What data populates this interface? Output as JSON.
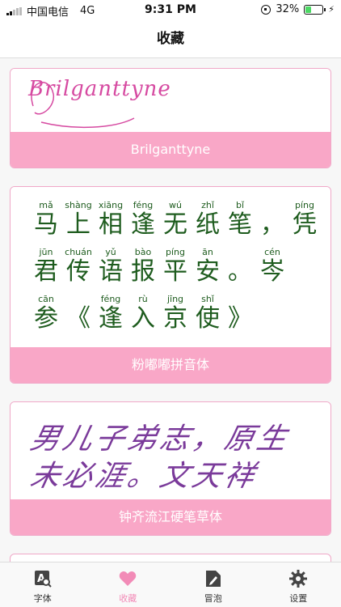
{
  "status": {
    "carrier": "中国电信",
    "network": "4G",
    "time": "9:31 PM",
    "battery": "32%",
    "battery_level": 0.32
  },
  "nav": {
    "title": "收藏"
  },
  "cards": [
    {
      "logo_text": "Brilganttyne",
      "name": "Brilganttyne"
    },
    {
      "name": "粉嘟嘟拼音体",
      "rows": [
        [
          {
            "py": "mǎ",
            "hz": "马"
          },
          {
            "py": "shàng",
            "hz": "上"
          },
          {
            "py": "xiāng",
            "hz": "相"
          },
          {
            "py": "féng",
            "hz": "逢"
          },
          {
            "py": "wú",
            "hz": "无"
          },
          {
            "py": "zhǐ",
            "hz": "纸"
          },
          {
            "py": "bǐ",
            "hz": "笔"
          },
          {
            "py": "",
            "hz": "，"
          },
          {
            "py": "píng",
            "hz": "凭"
          }
        ],
        [
          {
            "py": "jūn",
            "hz": "君"
          },
          {
            "py": "chuán",
            "hz": "传"
          },
          {
            "py": "yǔ",
            "hz": "语"
          },
          {
            "py": "bào",
            "hz": "报"
          },
          {
            "py": "píng",
            "hz": "平"
          },
          {
            "py": "ān",
            "hz": "安"
          },
          {
            "py": "",
            "hz": "。"
          },
          {
            "py": "cén",
            "hz": "岑"
          }
        ],
        [
          {
            "py": "cān",
            "hz": "参"
          },
          {
            "py": "",
            "hz": "《"
          },
          {
            "py": "féng",
            "hz": "逢"
          },
          {
            "py": "rù",
            "hz": "入"
          },
          {
            "py": "jīng",
            "hz": "京"
          },
          {
            "py": "shǐ",
            "hz": "使"
          },
          {
            "py": "",
            "hz": "》"
          }
        ]
      ]
    },
    {
      "line1": "男儿子弟志，原生",
      "line2": "未必涯。文天祥",
      "name": "钟齐流江硬笔草体"
    }
  ],
  "tabs": [
    {
      "label": "字体",
      "icon": "font-search-icon"
    },
    {
      "label": "收藏",
      "icon": "heart-icon"
    },
    {
      "label": "冒泡",
      "icon": "note-pen-icon"
    },
    {
      "label": "设置",
      "icon": "gear-icon"
    }
  ],
  "colors": {
    "accent": "#f28bb7",
    "card_footer": "#f9a7c7",
    "card_border": "#f0a8c8",
    "pinyin_green": "#1e5c1e",
    "handwriting_purple": "#7a3a9a"
  }
}
